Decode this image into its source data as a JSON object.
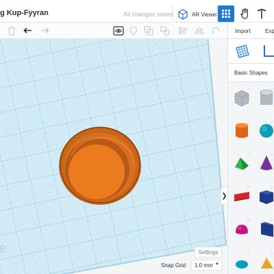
{
  "header": {
    "doc_title": "g Kup-Fyyran",
    "save_status": "All changes saved",
    "ar_viewer_label": "AR Viewer"
  },
  "right_panel": {
    "tabs": [
      "Import",
      "Expo"
    ],
    "category_label": "Basic Shapes",
    "shapes": [
      {
        "name": "box-hole",
        "color": "#b8bec6"
      },
      {
        "name": "cylinder-hole",
        "color": "#b8bec6"
      },
      {
        "name": "cylinder",
        "color": "#e8741c"
      },
      {
        "name": "sphere",
        "color": "#0aa2c0"
      },
      {
        "name": "roof",
        "color": "#21a33a"
      },
      {
        "name": "cone",
        "color": "#7a2f9c"
      },
      {
        "name": "text",
        "color": "#d4232a"
      },
      {
        "name": "box",
        "color": "#1f3a8a"
      },
      {
        "name": "half-sphere",
        "color": "#c2187a"
      },
      {
        "name": "wedge",
        "color": "#1f3a8a"
      },
      {
        "name": "paraboloid",
        "color": "#0aa2c0"
      },
      {
        "name": "pyramid",
        "color": "#e8a61c"
      }
    ]
  },
  "canvas": {
    "collapse_icon": "chevron-right-icon",
    "settings_label": "Settings",
    "snap_grid_label": "Snap Grid",
    "snap_grid_value": "1.0 mm",
    "workplane_color": "#cfe9f3",
    "object_color": "#e8741c"
  },
  "colors": {
    "accent": "#1d78d2"
  }
}
